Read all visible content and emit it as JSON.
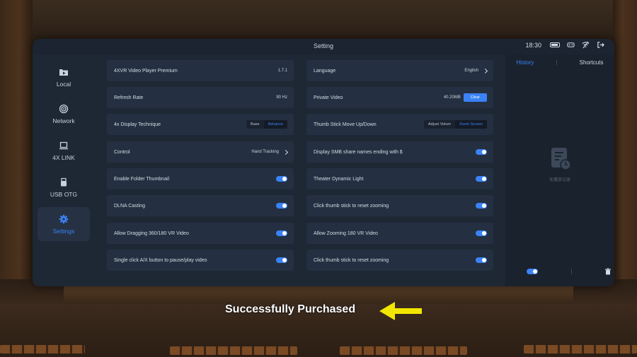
{
  "window": {
    "title": "Setting"
  },
  "status": {
    "time": "18:30"
  },
  "sidebar": {
    "items": [
      {
        "label": "Local",
        "icon": "play-folder-icon",
        "active": false
      },
      {
        "label": "Network",
        "icon": "network-icon",
        "active": false
      },
      {
        "label": "4X LINK",
        "icon": "laptop-icon",
        "active": false
      },
      {
        "label": "USB OTG",
        "icon": "usb-icon",
        "active": false
      },
      {
        "label": "Settings",
        "icon": "gear-icon",
        "active": true
      }
    ]
  },
  "settings": {
    "left": [
      {
        "label": "4XVR Video Player Premium",
        "value": "1.7.1"
      },
      {
        "label": "Refresh Rate",
        "value": "90 Hz"
      },
      {
        "label": "4x Display Technique",
        "options": [
          "Base",
          "Advance"
        ],
        "selected": "Advance"
      },
      {
        "label": "Control",
        "value": "Hand Tracking"
      },
      {
        "label": "Enable Folder Thumbnail",
        "toggle": true
      },
      {
        "label": "DLNA Casting",
        "toggle": true
      },
      {
        "label": "Allow Dragging 360/180 VR Video",
        "toggle": true
      },
      {
        "label": "Single click A/X button to pause/play video",
        "toggle": true
      }
    ],
    "right": [
      {
        "label": "Language",
        "value": "English"
      },
      {
        "label": "Private Video",
        "value": "40.20MB",
        "button": "Clear"
      },
      {
        "label": "Thumb Stick Move Up/Down",
        "options": [
          "Adjust Volum",
          "Zoom Screen"
        ],
        "selected": "Zoom Screen"
      },
      {
        "label": "Display SMB share names ending with $",
        "toggle": true
      },
      {
        "label": "Theater Dynamic Light",
        "toggle": true
      },
      {
        "label": "Click thumb stick to reset zooming",
        "toggle": true
      },
      {
        "label": "Allow Zooming 180 VR Video",
        "toggle": true
      },
      {
        "label": "Click thumb stick to reset zooming",
        "toggle": true
      }
    ]
  },
  "history_panel": {
    "tabs": [
      "History",
      "Shortcuts"
    ],
    "active_tab": "History",
    "empty_text": "无播放记录"
  },
  "caption": {
    "text": "Successfully Purchased"
  },
  "colors": {
    "accent": "#3b82f6",
    "panel": "#1e2835",
    "arrow": "#f2e600"
  }
}
